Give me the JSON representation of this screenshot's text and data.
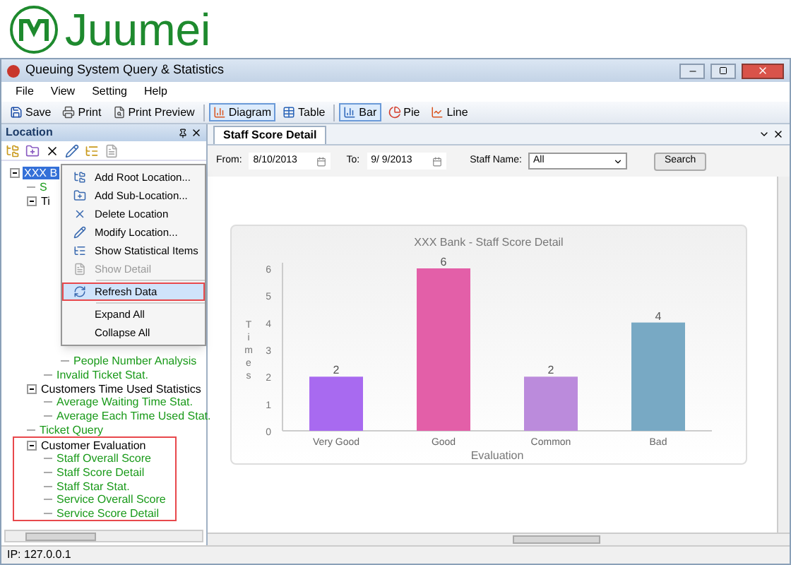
{
  "logo": {
    "text": "Juumei"
  },
  "window": {
    "title": "Queuing System Query & Statistics"
  },
  "menu_bar": [
    "File",
    "View",
    "Setting",
    "Help"
  ],
  "toolbar_groups": [
    [
      {
        "label": "Save",
        "selected": false
      },
      {
        "label": "Print",
        "selected": false
      },
      {
        "label": "Print Preview",
        "selected": false
      }
    ],
    [
      {
        "label": "Diagram",
        "selected": true
      },
      {
        "label": "Table",
        "selected": false
      }
    ],
    [
      {
        "label": "Bar",
        "selected": true
      },
      {
        "label": "Pie",
        "selected": false
      },
      {
        "label": "Line",
        "selected": false
      }
    ]
  ],
  "location_panel": {
    "title": "Location",
    "tree": [
      {
        "label": "XXX B",
        "kind": "group",
        "selected": true,
        "expanded": true,
        "highlighted": false,
        "children": [
          {
            "label": "S",
            "kind": "report",
            "selected": false,
            "highlighted": false
          },
          {
            "label": "Ti",
            "kind": "group",
            "selected": false,
            "expanded": true,
            "highlighted": false,
            "children": [
              {
                "kind": "covered",
                "children": [
                  {
                    "label": "People Number Analysis",
                    "kind": "report",
                    "selected": false,
                    "highlighted": false
                  }
                ]
              },
              {
                "label": "Invalid Ticket Stat.",
                "kind": "report",
                "selected": false,
                "highlighted": false
              }
            ]
          },
          {
            "label": "Customers Time Used Statistics",
            "kind": "group",
            "selected": false,
            "expanded": true,
            "highlighted": false,
            "children": [
              {
                "label": "Average Waiting Time Stat.",
                "kind": "report",
                "selected": false,
                "highlighted": false
              },
              {
                "label": "Average Each Time Used Stat.",
                "kind": "report",
                "selected": false,
                "highlighted": false
              }
            ]
          },
          {
            "label": "Ticket Query",
            "kind": "report",
            "selected": false,
            "highlighted": false
          },
          {
            "label": "Customer Evaluation",
            "kind": "group",
            "selected": false,
            "expanded": true,
            "highlighted": true,
            "children": [
              {
                "label": "Staff Overall Score",
                "kind": "report",
                "selected": false,
                "highlighted": false
              },
              {
                "label": "Staff Score Detail",
                "kind": "report",
                "selected": false,
                "highlighted": false
              },
              {
                "label": "Staff Star Stat.",
                "kind": "report",
                "selected": false,
                "highlighted": false
              },
              {
                "label": "Service Overall Score",
                "kind": "report",
                "selected": false,
                "highlighted": false
              },
              {
                "label": "Service Score Detail",
                "kind": "report",
                "selected": false,
                "highlighted": false
              }
            ]
          }
        ]
      }
    ]
  },
  "context_menu_groups": [
    [
      {
        "label": "Add Root Location...",
        "disabled": false,
        "selected": false,
        "highlighted": false
      },
      {
        "label": "Add Sub-Location...",
        "disabled": false,
        "selected": false,
        "highlighted": false
      },
      {
        "label": "Delete Location",
        "disabled": false,
        "selected": false,
        "highlighted": false
      },
      {
        "label": "Modify Location...",
        "disabled": false,
        "selected": false,
        "highlighted": false
      },
      {
        "label": "Show Statistical Items",
        "disabled": false,
        "selected": false,
        "highlighted": false
      },
      {
        "label": "Show Detail",
        "disabled": true,
        "selected": false,
        "highlighted": false
      }
    ],
    [
      {
        "label": "Refresh Data",
        "disabled": false,
        "selected": true,
        "highlighted": true
      }
    ],
    [
      {
        "label": "Expand All",
        "disabled": false,
        "selected": false,
        "highlighted": false
      },
      {
        "label": "Collapse All",
        "disabled": false,
        "selected": false,
        "highlighted": false
      }
    ]
  ],
  "document_tab": {
    "label": "Staff Score Detail",
    "selected": true
  },
  "filters": {
    "from_label": "From:",
    "from_value": "8/10/2013",
    "to_label": "To:",
    "to_value": "9/ 9/2013",
    "staff_label": "Staff Name:",
    "staff_value": "All",
    "search_button": "Search"
  },
  "chart": {
    "chart_data": {
      "type": "bar",
      "title": "XXX Bank - Staff Score Detail",
      "xlabel": "Evaluation",
      "ylabel": "Times",
      "categories": [
        "Very Good",
        "Good",
        "Common",
        "Bad"
      ],
      "values": [
        2,
        6,
        2,
        4
      ],
      "ylim": [
        0,
        6
      ],
      "yticks": [
        0,
        1,
        2,
        3,
        4,
        5,
        6
      ],
      "data_labels": true
    }
  },
  "status_bar": {
    "text": "IP: 127.0.0.1"
  }
}
